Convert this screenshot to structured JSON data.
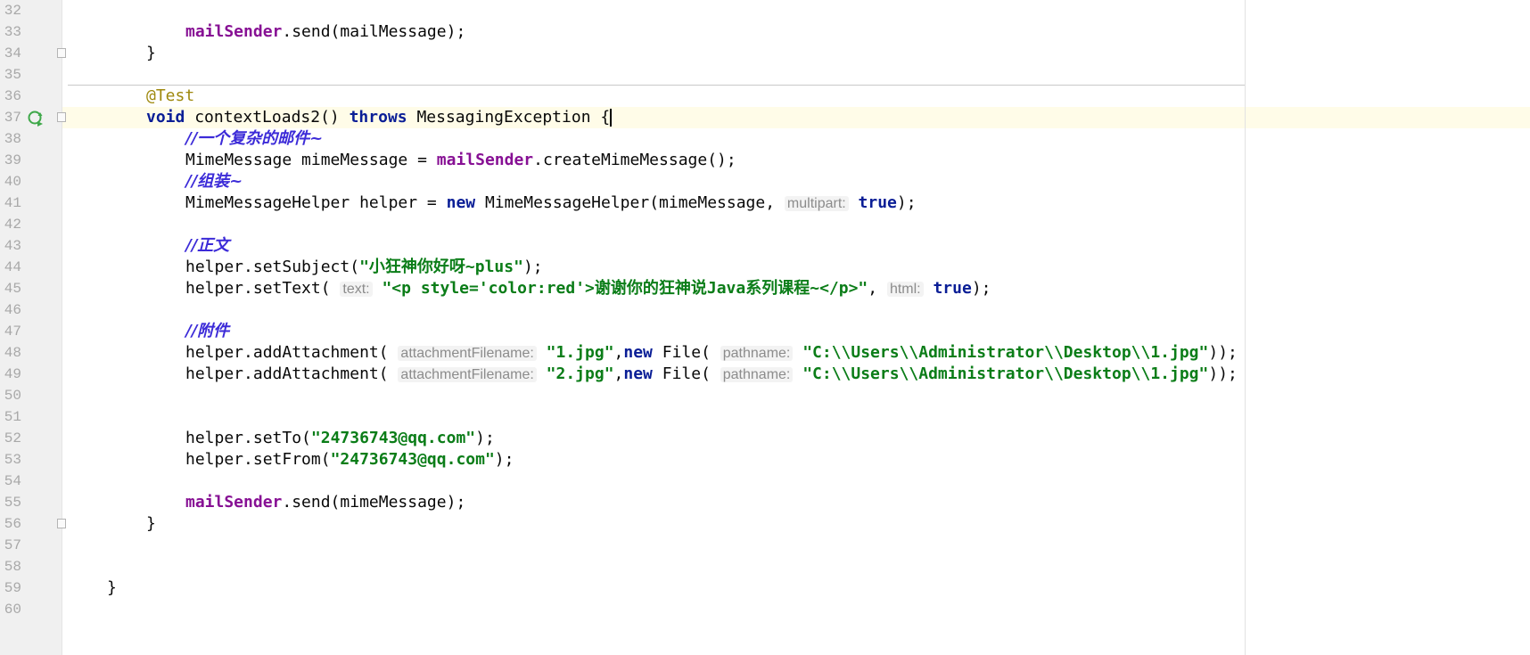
{
  "editor": {
    "lines": [
      {
        "n": "32",
        "indent": 0,
        "tokens": []
      },
      {
        "n": "33",
        "indent": 12,
        "tokens": [
          {
            "t": "mailSender",
            "c": "fld"
          },
          {
            "t": ".send(mailMessage);",
            "c": ""
          }
        ]
      },
      {
        "n": "34",
        "indent": 8,
        "tokens": [
          {
            "t": "}",
            "c": ""
          }
        ]
      },
      {
        "n": "35",
        "indent": 0,
        "tokens": []
      },
      {
        "n": "36",
        "indent": 8,
        "tokens": [
          {
            "t": "@Test",
            "c": "ann"
          }
        ]
      },
      {
        "n": "37",
        "indent": 8,
        "tokens": [
          {
            "t": "void",
            "c": "kw"
          },
          {
            "t": " contextLoads2() ",
            "c": ""
          },
          {
            "t": "throws",
            "c": "kw"
          },
          {
            "t": " MessagingException {",
            "c": ""
          },
          {
            "t": "",
            "c": "caret"
          }
        ]
      },
      {
        "n": "38",
        "indent": 12,
        "tokens": [
          {
            "t": "//一个复杂的邮件~",
            "c": "cmt"
          }
        ]
      },
      {
        "n": "39",
        "indent": 12,
        "tokens": [
          {
            "t": "MimeMessage mimeMessage = ",
            "c": ""
          },
          {
            "t": "mailSender",
            "c": "fld"
          },
          {
            "t": ".createMimeMessage();",
            "c": ""
          }
        ]
      },
      {
        "n": "40",
        "indent": 12,
        "tokens": [
          {
            "t": "//组装~",
            "c": "cmt"
          }
        ]
      },
      {
        "n": "41",
        "indent": 12,
        "tokens": [
          {
            "t": "MimeMessageHelper helper = ",
            "c": ""
          },
          {
            "t": "new",
            "c": "kw"
          },
          {
            "t": " MimeMessageHelper(mimeMessage, ",
            "c": ""
          },
          {
            "t": "multipart:",
            "c": "hint"
          },
          {
            "t": " ",
            "c": ""
          },
          {
            "t": "true",
            "c": "kw"
          },
          {
            "t": ");",
            "c": ""
          }
        ]
      },
      {
        "n": "42",
        "indent": 0,
        "tokens": []
      },
      {
        "n": "43",
        "indent": 12,
        "tokens": [
          {
            "t": "//正文",
            "c": "cmt"
          }
        ]
      },
      {
        "n": "44",
        "indent": 12,
        "tokens": [
          {
            "t": "helper.setSubject(",
            "c": ""
          },
          {
            "t": "\"小狂神你好呀~plus\"",
            "c": "str"
          },
          {
            "t": ");",
            "c": ""
          }
        ]
      },
      {
        "n": "45",
        "indent": 12,
        "tokens": [
          {
            "t": "helper.setText( ",
            "c": ""
          },
          {
            "t": "text:",
            "c": "hint"
          },
          {
            "t": " ",
            "c": ""
          },
          {
            "t": "\"<p style='color:red'>谢谢你的狂神说Java系列课程~</p>\"",
            "c": "str"
          },
          {
            "t": ", ",
            "c": ""
          },
          {
            "t": "html:",
            "c": "hint"
          },
          {
            "t": " ",
            "c": ""
          },
          {
            "t": "true",
            "c": "kw"
          },
          {
            "t": ");",
            "c": ""
          }
        ]
      },
      {
        "n": "46",
        "indent": 0,
        "tokens": []
      },
      {
        "n": "47",
        "indent": 12,
        "tokens": [
          {
            "t": "//附件",
            "c": "cmt"
          }
        ]
      },
      {
        "n": "48",
        "indent": 12,
        "tokens": [
          {
            "t": "helper.addAttachment( ",
            "c": ""
          },
          {
            "t": "attachmentFilename:",
            "c": "hint"
          },
          {
            "t": " ",
            "c": ""
          },
          {
            "t": "\"1.jpg\"",
            "c": "str"
          },
          {
            "t": ",",
            "c": ""
          },
          {
            "t": "new",
            "c": "kw"
          },
          {
            "t": " File( ",
            "c": ""
          },
          {
            "t": "pathname:",
            "c": "hint"
          },
          {
            "t": " ",
            "c": ""
          },
          {
            "t": "\"C:\\\\Users\\\\Administrator\\\\Desktop\\\\1.jpg\"",
            "c": "str"
          },
          {
            "t": "));",
            "c": ""
          }
        ]
      },
      {
        "n": "49",
        "indent": 12,
        "tokens": [
          {
            "t": "helper.addAttachment( ",
            "c": ""
          },
          {
            "t": "attachmentFilename:",
            "c": "hint"
          },
          {
            "t": " ",
            "c": ""
          },
          {
            "t": "\"2.jpg\"",
            "c": "str"
          },
          {
            "t": ",",
            "c": ""
          },
          {
            "t": "new",
            "c": "kw"
          },
          {
            "t": " File( ",
            "c": ""
          },
          {
            "t": "pathname:",
            "c": "hint"
          },
          {
            "t": " ",
            "c": ""
          },
          {
            "t": "\"C:\\\\Users\\\\Administrator\\\\Desktop\\\\1.jpg\"",
            "c": "str"
          },
          {
            "t": "));",
            "c": ""
          }
        ]
      },
      {
        "n": "50",
        "indent": 0,
        "tokens": []
      },
      {
        "n": "51",
        "indent": 0,
        "tokens": []
      },
      {
        "n": "52",
        "indent": 12,
        "tokens": [
          {
            "t": "helper.setTo(",
            "c": ""
          },
          {
            "t": "\"24736743@qq.com\"",
            "c": "str"
          },
          {
            "t": ");",
            "c": ""
          }
        ]
      },
      {
        "n": "53",
        "indent": 12,
        "tokens": [
          {
            "t": "helper.setFrom(",
            "c": ""
          },
          {
            "t": "\"24736743@qq.com\"",
            "c": "str"
          },
          {
            "t": ");",
            "c": ""
          }
        ]
      },
      {
        "n": "54",
        "indent": 0,
        "tokens": []
      },
      {
        "n": "55",
        "indent": 12,
        "tokens": [
          {
            "t": "mailSender",
            "c": "fld"
          },
          {
            "t": ".send(mimeMessage);",
            "c": ""
          }
        ]
      },
      {
        "n": "56",
        "indent": 8,
        "tokens": [
          {
            "t": "}",
            "c": ""
          }
        ]
      },
      {
        "n": "57",
        "indent": 0,
        "tokens": []
      },
      {
        "n": "58",
        "indent": 0,
        "tokens": []
      },
      {
        "n": "59",
        "indent": 4,
        "tokens": [
          {
            "t": "}",
            "c": ""
          }
        ]
      },
      {
        "n": "60",
        "indent": 0,
        "tokens": []
      }
    ]
  },
  "colors": {
    "keyword": "#0a1e96",
    "field": "#871094",
    "string": "#0b7d18",
    "annotation": "#9e880d",
    "comment": "#3c2bd8",
    "hint": "#8c8c8c",
    "gutter_bg": "#f0f0f0",
    "caret_line": "#fffce8"
  },
  "icons": {
    "run_gutter": "run-test-icon",
    "fold_markers": [
      "34",
      "37",
      "56"
    ]
  }
}
